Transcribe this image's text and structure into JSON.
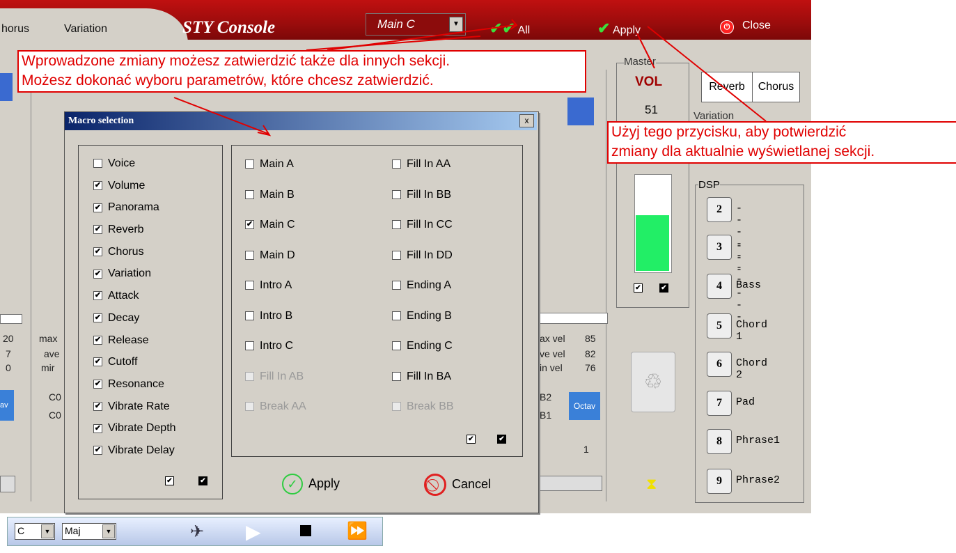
{
  "topbar": {
    "tabs": [
      "horus",
      "Variation"
    ],
    "title": "STY Console",
    "section_value": "Main C",
    "all_label": "All",
    "apply_label": "Apply",
    "close_label": "Close"
  },
  "master": {
    "label": "Master",
    "vol_label": "VOL",
    "vol_value": "51",
    "meter_level_fraction": 0.57
  },
  "fx": {
    "reverb": "Reverb",
    "chorus": "Chorus",
    "variation_label": "Variation"
  },
  "dsp": {
    "label": "DSP",
    "items": [
      {
        "num": "2",
        "name": "-------"
      },
      {
        "num": "3",
        "name": "-------"
      },
      {
        "num": "4",
        "name": "Bass"
      },
      {
        "num": "5",
        "name": "Chord 1"
      },
      {
        "num": "6",
        "name": "Chord 2"
      },
      {
        "num": "7",
        "name": "Pad"
      },
      {
        "num": "8",
        "name": "Phrase1"
      },
      {
        "num": "9",
        "name": "Phrase2"
      }
    ]
  },
  "strip_left": {
    "vals": [
      "20",
      "7",
      "0"
    ],
    "labels": [
      "max",
      "ave",
      "mir"
    ],
    "notes": [
      "C0",
      "C0"
    ],
    "octave": "av"
  },
  "strip_right": {
    "labels": [
      "ax vel",
      "ve vel",
      "in vel"
    ],
    "vals": [
      "85",
      "82",
      "76"
    ],
    "notes": [
      "B2",
      "B1"
    ],
    "octave": "Octav",
    "extra": "1"
  },
  "bottom": {
    "key": "C",
    "scale": "Maj"
  },
  "dialog": {
    "title": "Macro selection",
    "close": "x",
    "params": [
      {
        "label": "Voice",
        "checked": false
      },
      {
        "label": "Volume",
        "checked": true
      },
      {
        "label": "Panorama",
        "checked": true
      },
      {
        "label": "Reverb",
        "checked": true
      },
      {
        "label": "Chorus",
        "checked": true
      },
      {
        "label": "Variation",
        "checked": true
      },
      {
        "label": "Attack",
        "checked": true
      },
      {
        "label": "Decay",
        "checked": true
      },
      {
        "label": "Release",
        "checked": true
      },
      {
        "label": "Cutoff",
        "checked": true
      },
      {
        "label": "Resonance",
        "checked": true
      },
      {
        "label": "Vibrate Rate",
        "checked": true
      },
      {
        "label": "Vibrate Depth",
        "checked": true
      },
      {
        "label": "Vibrate Delay",
        "checked": true
      }
    ],
    "sections_col1": [
      {
        "label": "Main A",
        "checked": false,
        "disabled": false
      },
      {
        "label": "Main B",
        "checked": false,
        "disabled": false
      },
      {
        "label": "Main C",
        "checked": true,
        "disabled": false
      },
      {
        "label": "Main D",
        "checked": false,
        "disabled": false
      },
      {
        "label": "Intro A",
        "checked": false,
        "disabled": false
      },
      {
        "label": "Intro B",
        "checked": false,
        "disabled": false
      },
      {
        "label": "Intro C",
        "checked": false,
        "disabled": false
      },
      {
        "label": "Fill In AB",
        "checked": false,
        "disabled": true
      },
      {
        "label": "Break AA",
        "checked": false,
        "disabled": true
      }
    ],
    "sections_col2": [
      {
        "label": "Fill In AA",
        "checked": false,
        "disabled": false
      },
      {
        "label": "Fill In BB",
        "checked": false,
        "disabled": false
      },
      {
        "label": "Fill In CC",
        "checked": false,
        "disabled": false
      },
      {
        "label": "Fill In DD",
        "checked": false,
        "disabled": false
      },
      {
        "label": "Ending A",
        "checked": false,
        "disabled": false
      },
      {
        "label": "Ending B",
        "checked": false,
        "disabled": false
      },
      {
        "label": "Ending C",
        "checked": false,
        "disabled": false
      },
      {
        "label": "Fill In BA",
        "checked": false,
        "disabled": false
      },
      {
        "label": "Break BB",
        "checked": false,
        "disabled": true
      }
    ],
    "apply": "Apply",
    "cancel": "Cancel"
  },
  "annotations": {
    "note1_line1": "Wprowadzone zmiany możesz zatwierdzić także dla innych sekcji.",
    "note1_line2": "Możesz dokonać wyboru parametrów, które chcesz zatwierdzić.",
    "note2_line1": "Użyj tego przycisku, aby potwierdzić",
    "note2_line2": "zmiany dla aktualnie wyświetlanej sekcji."
  },
  "colors": {
    "topbar": "#9a0c0c",
    "panel": "#d4d0c8",
    "annotation": "#e00000",
    "meter": "#22ee66"
  }
}
